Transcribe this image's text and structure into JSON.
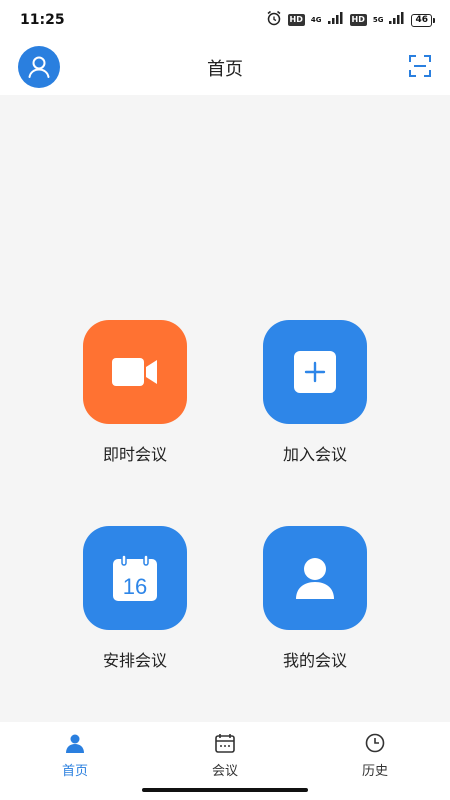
{
  "status_bar": {
    "time": "11:25",
    "hd_badge_1": "HD",
    "network_1": "4G",
    "hd_badge_2": "HD",
    "network_2": "5G",
    "battery": "46"
  },
  "header": {
    "title": "首页",
    "avatar_icon": "user-icon",
    "scan_icon": "scan-icon"
  },
  "actions": [
    {
      "label": "即时会议",
      "icon": "video-camera-icon",
      "color": "#ff7232"
    },
    {
      "label": "加入会议",
      "icon": "plus-square-icon",
      "color": "#2e86e8"
    },
    {
      "label": "安排会议",
      "icon": "calendar-icon",
      "color": "#2e86e8",
      "icon_text": "16"
    },
    {
      "label": "我的会议",
      "icon": "person-icon",
      "color": "#2e86e8"
    }
  ],
  "tabs": [
    {
      "label": "首页",
      "icon": "home-person-icon",
      "active": true
    },
    {
      "label": "会议",
      "icon": "calendar-icon",
      "active": false
    },
    {
      "label": "历史",
      "icon": "clock-icon",
      "active": false
    }
  ],
  "colors": {
    "accent": "#2a7fdf",
    "orange": "#ff7232"
  }
}
